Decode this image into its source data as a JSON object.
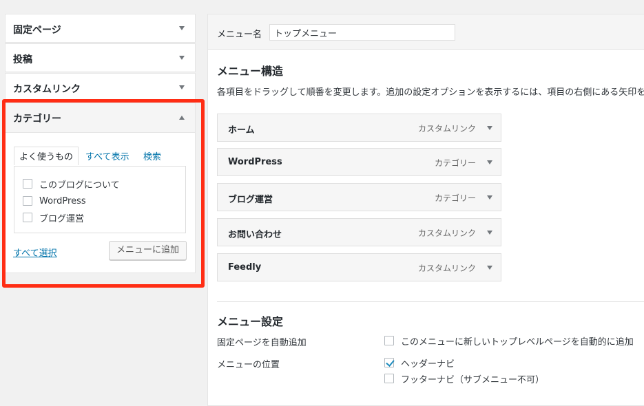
{
  "left": {
    "accordion": [
      {
        "title": "固定ページ"
      },
      {
        "title": "投稿"
      },
      {
        "title": "カスタムリンク"
      }
    ],
    "category": {
      "title": "カテゴリー",
      "tabs": [
        "よく使うもの",
        "すべて表示",
        "検索"
      ],
      "items": [
        "このブログについて",
        "WordPress",
        "ブログ運営"
      ],
      "select_all": "すべて選択",
      "add_button": "メニューに追加"
    }
  },
  "right": {
    "menu_name_label": "メニュー名",
    "menu_name_value": "トップメニュー",
    "structure_title": "メニュー構造",
    "structure_desc": "各項目をドラッグして順番を変更します。追加の設定オプションを表示するには、項目の右側にある矢印を",
    "menu_items": [
      {
        "title": "ホーム",
        "type": "カスタムリンク"
      },
      {
        "title": "WordPress",
        "type": "カテゴリー"
      },
      {
        "title": "ブログ運営",
        "type": "カテゴリー"
      },
      {
        "title": "お問い合わせ",
        "type": "カスタムリンク"
      },
      {
        "title": "Feedly",
        "type": "カスタムリンク"
      }
    ],
    "settings_title": "メニュー設定",
    "auto_add_label": "固定ページを自動追加",
    "auto_add_option": "このメニューに新しいトップレベルページを自動的に追加",
    "location_label": "メニューの位置",
    "location_options": [
      {
        "label": "ヘッダーナビ",
        "checked": true
      },
      {
        "label": "フッターナビ（サブメニュー不可）",
        "checked": false
      }
    ]
  },
  "colors": {
    "highlight": "#ff2d14",
    "link": "#0073aa",
    "check": "#1e8cbe"
  }
}
